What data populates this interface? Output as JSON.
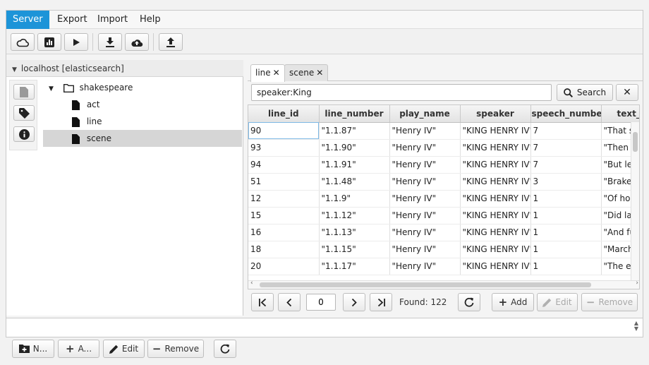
{
  "menu": [
    "Server",
    "Export",
    "Import",
    "Help"
  ],
  "connection": {
    "label": "localhost [elasticsearch]"
  },
  "tree": {
    "index": "shakespeare",
    "types": [
      "act",
      "line",
      "scene"
    ],
    "selected": "scene"
  },
  "left_buttons": {
    "new": "N...",
    "add": "A...",
    "edit": "Edit",
    "remove": "Remove"
  },
  "tabs": [
    {
      "label": "line"
    },
    {
      "label": "scene"
    }
  ],
  "search": {
    "query": "speaker:King",
    "button": "Search"
  },
  "table": {
    "columns": [
      "line_id",
      "line_number",
      "play_name",
      "speaker",
      "speech_number",
      "text_en"
    ],
    "rows": [
      [
        "90",
        "\"1.1.87\"",
        "\"Henry IV\"",
        "\"KING HENRY IV\"",
        "7",
        "\"That sc"
      ],
      [
        "93",
        "\"1.1.90\"",
        "\"Henry IV\"",
        "\"KING HENRY IV\"",
        "7",
        "\"Then w"
      ],
      [
        "94",
        "\"1.1.91\"",
        "\"Henry IV\"",
        "\"KING HENRY IV\"",
        "7",
        "\"But let"
      ],
      [
        "51",
        "\"1.1.48\"",
        "\"Henry IV\"",
        "\"KING HENRY IV\"",
        "3",
        "\"Brake o"
      ],
      [
        "12",
        "\"1.1.9\"",
        "\"Henry IV\"",
        "\"KING HENRY IV\"",
        "1",
        "\"Of host"
      ],
      [
        "15",
        "\"1.1.12\"",
        "\"Henry IV\"",
        "\"KING HENRY IV\"",
        "1",
        "\"Did late"
      ],
      [
        "16",
        "\"1.1.13\"",
        "\"Henry IV\"",
        "\"KING HENRY IV\"",
        "1",
        "\"And fu"
      ],
      [
        "18",
        "\"1.1.15\"",
        "\"Henry IV\"",
        "\"KING HENRY IV\"",
        "1",
        "\"March"
      ],
      [
        "20",
        "\"1.1.17\"",
        "\"Henry IV\"",
        "\"KING HENRY IV\"",
        "1",
        "\"The ed"
      ]
    ]
  },
  "pager": {
    "page": "0",
    "found": "Found: 122",
    "add": "Add",
    "edit": "Edit",
    "remove": "Remove"
  },
  "colors": {
    "menu_active": "#1d94d8"
  }
}
